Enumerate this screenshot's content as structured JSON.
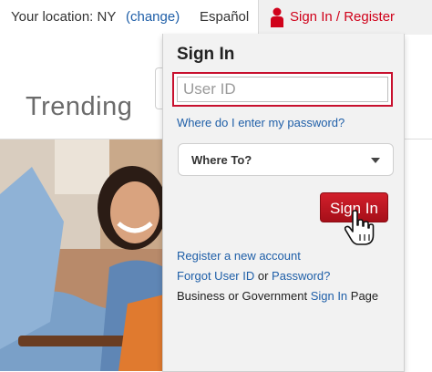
{
  "header": {
    "location_label": "Your location: NY",
    "change_link": "(change)",
    "language_link": "Español",
    "signin_register": "Sign In / Register"
  },
  "page": {
    "trending_heading": "Trending"
  },
  "signin_panel": {
    "title": "Sign In",
    "userid_placeholder": "User ID",
    "where_password_link": "Where do I enter my password?",
    "where_to_select": "Where To?",
    "signin_button": "Sign In",
    "register_link": "Register a new account",
    "forgot_userid_link": "Forgot User ID",
    "forgot_or": " or ",
    "password_link": "Password?",
    "biz_prefix": "Business or Government ",
    "biz_link": "Sign In",
    "biz_suffix": " Page"
  },
  "colors": {
    "brand_red": "#d0021b",
    "link_blue": "#1f5fa8",
    "panel_bg": "#f2f2f2"
  }
}
